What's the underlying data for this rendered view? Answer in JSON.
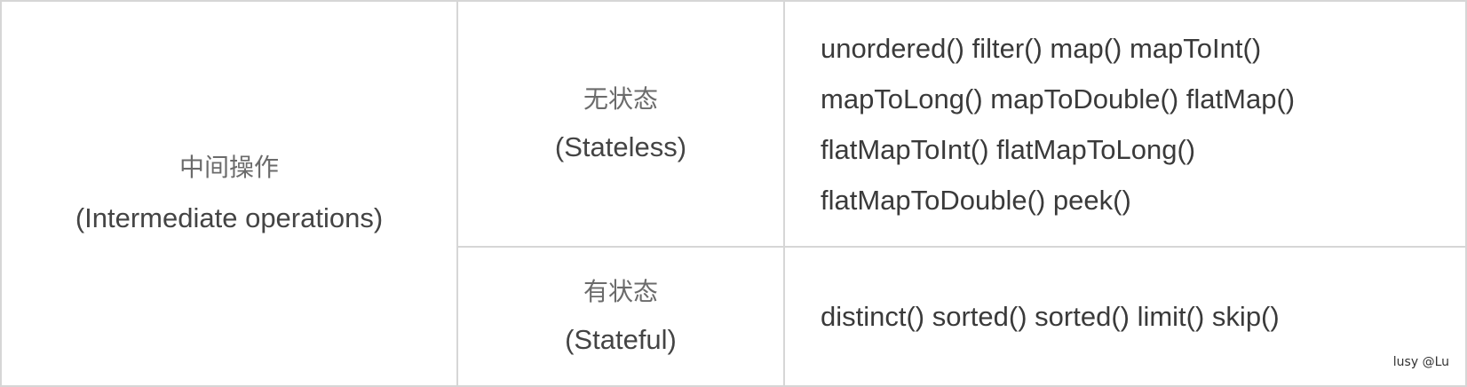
{
  "category": {
    "cn": "中间操作",
    "en": "(Intermediate operations)"
  },
  "stateless": {
    "cn": "无状态",
    "en": "(Stateless)",
    "method_lines": [
      "unordered() filter() map() mapToInt()",
      "mapToLong() mapToDouble() flatMap()",
      "flatMapToInt() flatMapToLong()",
      "flatMapToDouble() peek()"
    ]
  },
  "stateful": {
    "cn": "有状态",
    "en": "(Stateful)",
    "method_lines": [
      "distinct() sorted() sorted() limit() skip()"
    ]
  },
  "watermark": "lusy @Lu"
}
